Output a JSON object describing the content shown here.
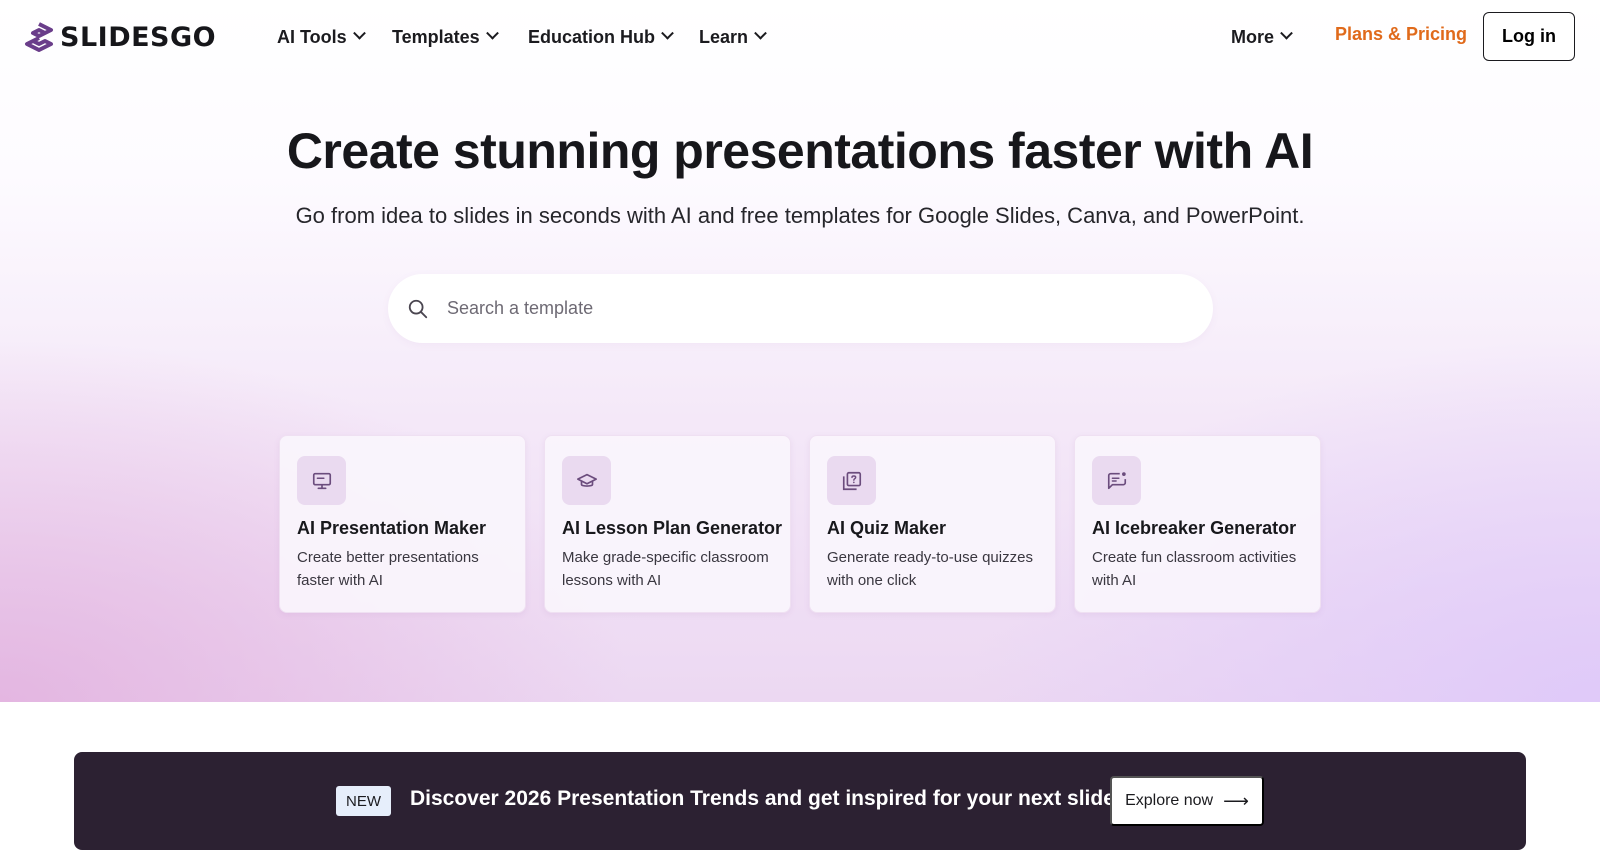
{
  "header": {
    "logo_text": "SLIDESGO",
    "nav": {
      "ai_tools": "AI Tools",
      "templates": "Templates",
      "education_hub": "Education Hub",
      "learn": "Learn",
      "more": "More"
    },
    "pricing": "Plans & Pricing",
    "login": "Log in"
  },
  "hero": {
    "title": "Create stunning presentations faster with AI",
    "subtitle": "Go from idea to slides in seconds with AI and free templates for Google Slides, Canva, and PowerPoint.",
    "search": {
      "placeholder": "Search a template",
      "value": ""
    }
  },
  "tools": [
    {
      "icon": "monitor-icon",
      "title": "AI Presentation Maker",
      "desc": "Create better presentations faster with AI"
    },
    {
      "icon": "graduation-cap-icon",
      "title": "AI Lesson Plan Generator",
      "desc": "Make grade-specific classroom lessons with AI"
    },
    {
      "icon": "quiz-icon",
      "title": "AI Quiz Maker",
      "desc": "Generate ready-to-use quizzes with one click"
    },
    {
      "icon": "chat-bubble-icon",
      "title": "AI Icebreaker Generator",
      "desc": "Create fun classroom activities with AI"
    }
  ],
  "banner": {
    "badge": "NEW",
    "text": "Discover 2026 Presentation Trends and get inspired for your next slides",
    "cta": "Explore now",
    "cta_icon": "arrow-right-icon"
  },
  "colors": {
    "brand": "#6a3d8a",
    "pricing": "#e06a1b",
    "banner_bg": "#2c2132",
    "card_icon_bg": "#eadaf0"
  }
}
